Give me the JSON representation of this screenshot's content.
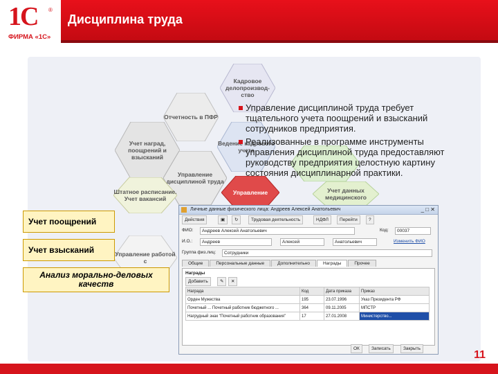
{
  "header": {
    "logo_text": "1С",
    "logo_reg": "®",
    "firm": "ФИРМА «1С»",
    "title": "Дисциплина труда"
  },
  "hexes": [
    {
      "label": "Кадровое делопроизвод-ство",
      "color": "#e6e6f2"
    },
    {
      "label": "Отчетность в ПФР",
      "color": "#ececec"
    },
    {
      "label": "Учет наград, поощрений и взысканий",
      "color": "#e4e4e4"
    },
    {
      "label": "Ведение кадрового учета",
      "color": "#dde4f2"
    },
    {
      "label": "Управление дисциплиной труда",
      "color": "#e8e8e8"
    },
    {
      "label": "Управление",
      "color": "#e04a4a"
    },
    {
      "label": "Штатное расписание. Учет вакансий",
      "color": "#f0f3dc"
    },
    {
      "label": "Учет данных медицинского",
      "color": "#e3f0cf"
    },
    {
      "label": "Управление работой с",
      "color": "#f3f3f3"
    },
    {
      "label": "",
      "color": "#dcefd0"
    }
  ],
  "bullets": [
    "Управление дисциплиной труда требует тщательного учета поощрений и взысканий сотрудников предприятия.",
    "Реализованные в программе инструменты управления дисциплиной труда предоставляют руководству предприятия целостную картину состояния дисциплинарной практики."
  ],
  "labels": {
    "a": "Учет поощрений",
    "b": "Учет взысканий",
    "c": "Анализ морально-деловых качеств"
  },
  "window": {
    "title": "Личные данные физического лица: Андреев Алексей Анатольевич",
    "actions": "Действия",
    "goto": "Перейти",
    "labor": "Трудовая деятельность",
    "ndfl": "НДФЛ",
    "help_btn": "Все",
    "fio_lbl": "ФИО:",
    "fio": "Андреев Алексей Анатольевич",
    "code_lbl": "Код:",
    "code": "00037",
    "names_lbl": "И.О.:",
    "name1": "Андреев",
    "name2": "Алексей",
    "name3": "Анатольевич",
    "names_link": "Изменить ФИО",
    "group_lbl": "Группа физ.лиц:",
    "group": "Сотрудники",
    "tabs": [
      "Общие",
      "Персональные данные",
      "Дополнительно",
      "Награды",
      "Прочее"
    ],
    "active_tab": 3,
    "section": "Награды",
    "add_btn": "Добавить",
    "columns": [
      "Награда",
      "Код",
      "Дата приказа",
      "Приказ"
    ],
    "rows": [
      [
        "Орден Мужества",
        "195",
        "23.07.1996",
        "Указ Президента РФ"
      ],
      [
        "Почетный ... Почетный работник бюджетного ...",
        "364",
        "09.11.2005",
        "МПСТР"
      ],
      [
        "Нагрудный знак \"Почетный работник образования\"",
        "17",
        "27.01.2008",
        "Министерство..."
      ]
    ],
    "status": [
      "ОК",
      "Записать",
      "Закрыть"
    ]
  },
  "page_number": "11"
}
